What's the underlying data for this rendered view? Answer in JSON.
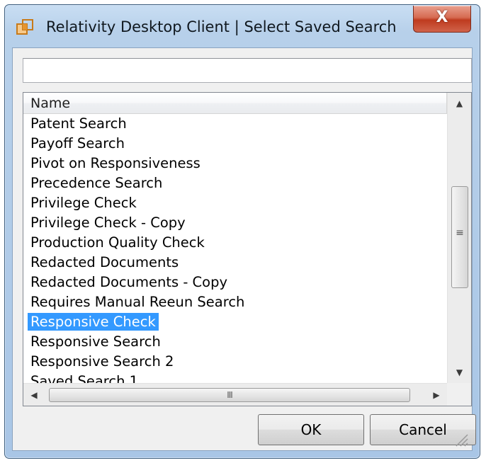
{
  "window": {
    "title": "Relativity Desktop Client | Select Saved Search",
    "close_glyph": "X"
  },
  "search": {
    "value": "",
    "placeholder": ""
  },
  "list": {
    "column_header": "Name",
    "items": [
      "Patent Search",
      "Payoff Search",
      "Pivot on Responsiveness",
      "Precedence Search",
      "Privilege Check",
      "Privilege Check - Copy",
      "Production Quality Check",
      "Redacted Documents",
      "Redacted Documents - Copy",
      "Requires Manual Reeun Search",
      "Responsive Check",
      "Responsive Search",
      "Responsive Search 2",
      "Saved Search 1"
    ],
    "selected_index": 10,
    "selected_item": "Responsive Check"
  },
  "scrollbars": {
    "up_arrow": "▲",
    "down_arrow": "▼",
    "left_arrow": "◀",
    "right_arrow": "▶",
    "v_grip": "≡",
    "h_grip": "III"
  },
  "buttons": {
    "ok_label": "OK",
    "cancel_label": "Cancel"
  },
  "icons": {
    "app_icon": "relativity-app-icon",
    "close_icon": "close-icon",
    "resize_icon": "resize-grip-icon"
  },
  "colors": {
    "selection": "#3399ff",
    "close_button": "#c94a30",
    "window_frame": "#b7d0ea"
  }
}
